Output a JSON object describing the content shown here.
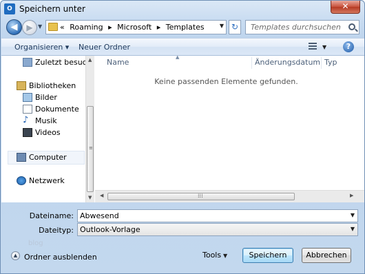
{
  "window": {
    "title": "Speichern unter",
    "app_icon": "outlook-icon",
    "close_label": "✕"
  },
  "nav": {
    "back_icon": "back-arrow-icon",
    "forward_icon": "forward-arrow-icon"
  },
  "address": {
    "prefix": "«",
    "parts": [
      "Roaming",
      "Microsoft",
      "Templates"
    ]
  },
  "search": {
    "placeholder": "Templates durchsuchen"
  },
  "toolbar": {
    "organize": "Organisieren ▾",
    "new_folder": "Neuer Ordner"
  },
  "sidebar": {
    "items": [
      {
        "label": "Zuletzt besucht",
        "icon": "recent-places-icon"
      },
      {
        "label": "Bibliotheken",
        "icon": "libraries-icon"
      },
      {
        "label": "Bilder",
        "icon": "pictures-icon"
      },
      {
        "label": "Dokumente",
        "icon": "documents-icon"
      },
      {
        "label": "Musik",
        "icon": "music-icon"
      },
      {
        "label": "Videos",
        "icon": "videos-icon"
      },
      {
        "label": "Computer",
        "icon": "computer-icon"
      },
      {
        "label": "Netzwerk",
        "icon": "network-icon"
      }
    ]
  },
  "list": {
    "columns": [
      "Name",
      "Änderungsdatum",
      "Typ"
    ],
    "empty_message": "Keine passenden Elemente gefunden."
  },
  "form": {
    "filename_label": "Dateiname:",
    "filename_value": "Abwesend",
    "filetype_label": "Dateityp:",
    "filetype_value": "Outlook-Vorlage"
  },
  "watermark": "blog",
  "footer": {
    "hide_folders": "Ordner ausblenden",
    "tools": "Tools",
    "save": "Speichern",
    "cancel": "Abbrechen"
  },
  "colors": {
    "accent": "#3c7fb1",
    "toolbar": "#dbe7f6",
    "close": "#c7503a"
  }
}
